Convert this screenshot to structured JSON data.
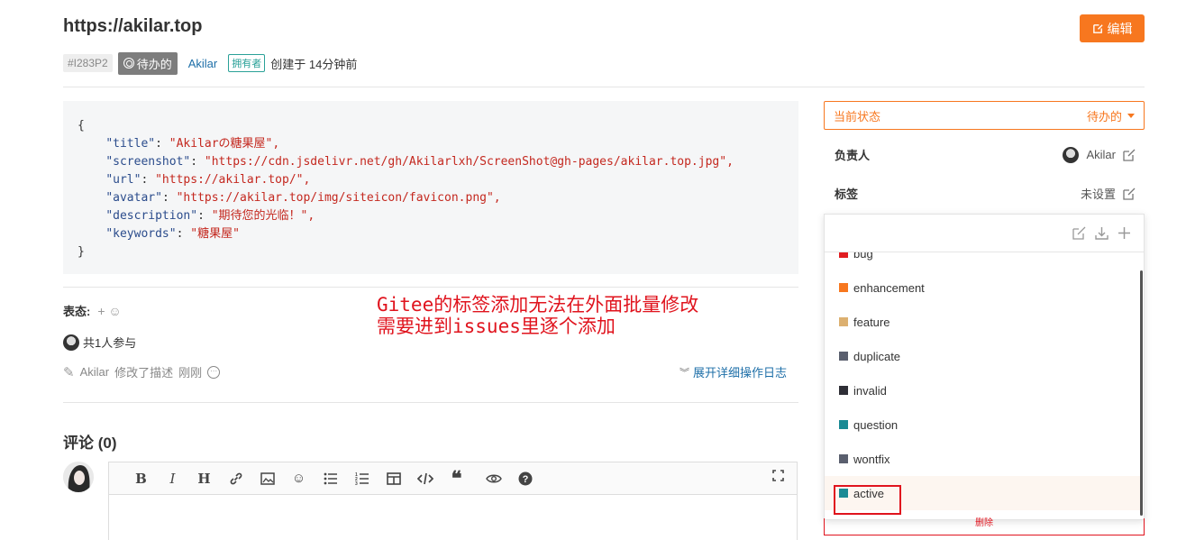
{
  "issue": {
    "title": "https://akilar.top",
    "id": "#I283P2",
    "state": "待办的",
    "author": "Akilar",
    "owner_tag": "拥有者",
    "created": "创建于 14分钟前"
  },
  "header": {
    "edit_label": "编辑"
  },
  "code_lines": [
    {
      "key": "",
      "value": "{"
    },
    {
      "key": "\"title\"",
      "value": "\"Akilarの糖果屋\","
    },
    {
      "key": "\"screenshot\"",
      "value": "\"https://cdn.jsdelivr.net/gh/Akilarlxh/ScreenShot@gh-pages/akilar.top.jpg\","
    },
    {
      "key": "\"url\"",
      "value": "\"https://akilar.top/\","
    },
    {
      "key": "\"avatar\"",
      "value": "\"https://akilar.top/img/siteicon/favicon.png\","
    },
    {
      "key": "\"description\"",
      "value": "\"期待您的光临！\","
    },
    {
      "key": "\"keywords\"",
      "value": "\"糖果屋\""
    },
    {
      "key": "",
      "value": "}"
    }
  ],
  "reactions": {
    "label": "表态:",
    "add": "+"
  },
  "annotation": {
    "line1": "Gitee的标签添加无法在外面批量修改",
    "line2": "需要进到issues里逐个添加"
  },
  "participants": {
    "text": "共1人参与"
  },
  "activity": {
    "user": "Akilar",
    "action": "修改了描述",
    "time": "刚刚",
    "expand_log": "展开详细操作日志"
  },
  "comments": {
    "title": "评论 (0)"
  },
  "sidebar": {
    "status_label": "当前状态",
    "status_value": "待办的",
    "assignee_label": "负责人",
    "assignee_value": "Akilar",
    "labels_label": "标签",
    "labels_value": "未设置",
    "delete_hint": "删除"
  },
  "label_options": [
    {
      "name": "bug",
      "color": "#e11d21"
    },
    {
      "name": "enhancement",
      "color": "#f7771f"
    },
    {
      "name": "feature",
      "color": "#dcb070"
    },
    {
      "name": "duplicate",
      "color": "#5a5f6e"
    },
    {
      "name": "invalid",
      "color": "#2e2e36"
    },
    {
      "name": "question",
      "color": "#1a8a94"
    },
    {
      "name": "wontfix",
      "color": "#5a5f6e"
    },
    {
      "name": "active",
      "color": "#1a8a94"
    }
  ],
  "colors": {
    "accent": "#f7771f",
    "annotation": "#e0141e",
    "link": "#1e6fa8"
  }
}
